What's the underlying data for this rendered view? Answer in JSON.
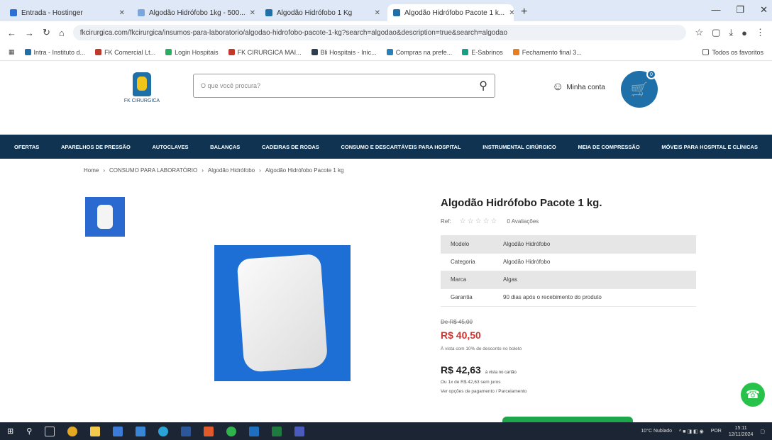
{
  "browser": {
    "tabs": [
      {
        "label": "Entrada - Hostinger",
        "color": "#2b6fd6",
        "active": false
      },
      {
        "label": "Algodão Hidrófobo 1kg - 500...",
        "color": "#7aa6dc",
        "active": false
      },
      {
        "label": "Algodão Hidrófobo 1 Kg",
        "color": "#1f6fa8",
        "active": false
      },
      {
        "label": "Algodão Hidrófobo Pacote 1 k...",
        "color": "#1f6fa8",
        "active": true
      }
    ],
    "new_tab": "+",
    "url": "fkcirurgica.com/fkcirurgica/insumos-para-laboratorio/algodao-hidrofobo-pacote-1-kg?search=algodao&description=true&search=algodao",
    "bookmarks": [
      {
        "label": "Intra - Instituto d...",
        "color": "#1f6fa8"
      },
      {
        "label": "FK Comercial Lt...",
        "color": "#c0392b"
      },
      {
        "label": "Login Hospitais",
        "color": "#27ae60"
      },
      {
        "label": "FK CIRURGICA MAI...",
        "color": "#c0392b"
      },
      {
        "label": "Bli Hospitais - Inic...",
        "color": "#2c3e50"
      },
      {
        "label": "Compras na prefe...",
        "color": "#2980b9"
      },
      {
        "label": "E-Sabrinos",
        "color": "#16a085"
      },
      {
        "label": "Fechamento final 3...",
        "color": "#e67e22"
      }
    ],
    "bookmarks_right": "Todos os favoritos"
  },
  "header": {
    "logo_text": "FK CIRURGICA",
    "search_placeholder": "O que você procura?",
    "account_label": "Minha conta",
    "cart_count": "0"
  },
  "nav": [
    "OFERTAS",
    "APARELHOS DE PRESSÃO",
    "AUTOCLAVES",
    "BALANÇAS",
    "CADEIRAS DE RODAS",
    "CONSUMO E DESCARTÁVEIS PARA HOSPITAL",
    "INSTRUMENTAL CIRÚRGICO",
    "MEIA DE COMPRESSÃO",
    "MÓVEIS PARA HOSPITAL E CLÍNICAS"
  ],
  "breadcrumb": [
    "Home",
    "CONSUMO PARA LABORATÓRIO",
    "Algodão Hidrófobo",
    "Algodão Hidrófobo Pacote 1 kg"
  ],
  "product": {
    "title": "Algodão Hidrófobo Pacote 1 kg.",
    "sku": "Ref:",
    "stars": "☆☆☆☆☆",
    "reviews": "0 Avaliações",
    "specs": [
      {
        "key": "Modelo",
        "value": "Algodão Hidrófobo"
      },
      {
        "key": "Categoria",
        "value": "Algodão Hidrófobo"
      },
      {
        "key": "Marca",
        "value": "Algas"
      },
      {
        "key": "Garantia",
        "value": "90 dias após o recebimento do produto"
      }
    ],
    "old_price": "De R$ 45,00",
    "price": "R$ 40,50",
    "price_note": "À vista com 10% de desconto no boleto",
    "price2": "R$ 42,63",
    "price2_label": "à vista no cartão",
    "installments": "Ou 1x de R$ 42,63 sem juros",
    "payment_link": "Ver opções de pagamento / Parcelamento"
  },
  "taskbar": {
    "weather": "10°C Nublado",
    "time": "15:11",
    "date": "12/11/2024",
    "lang": "POR"
  }
}
